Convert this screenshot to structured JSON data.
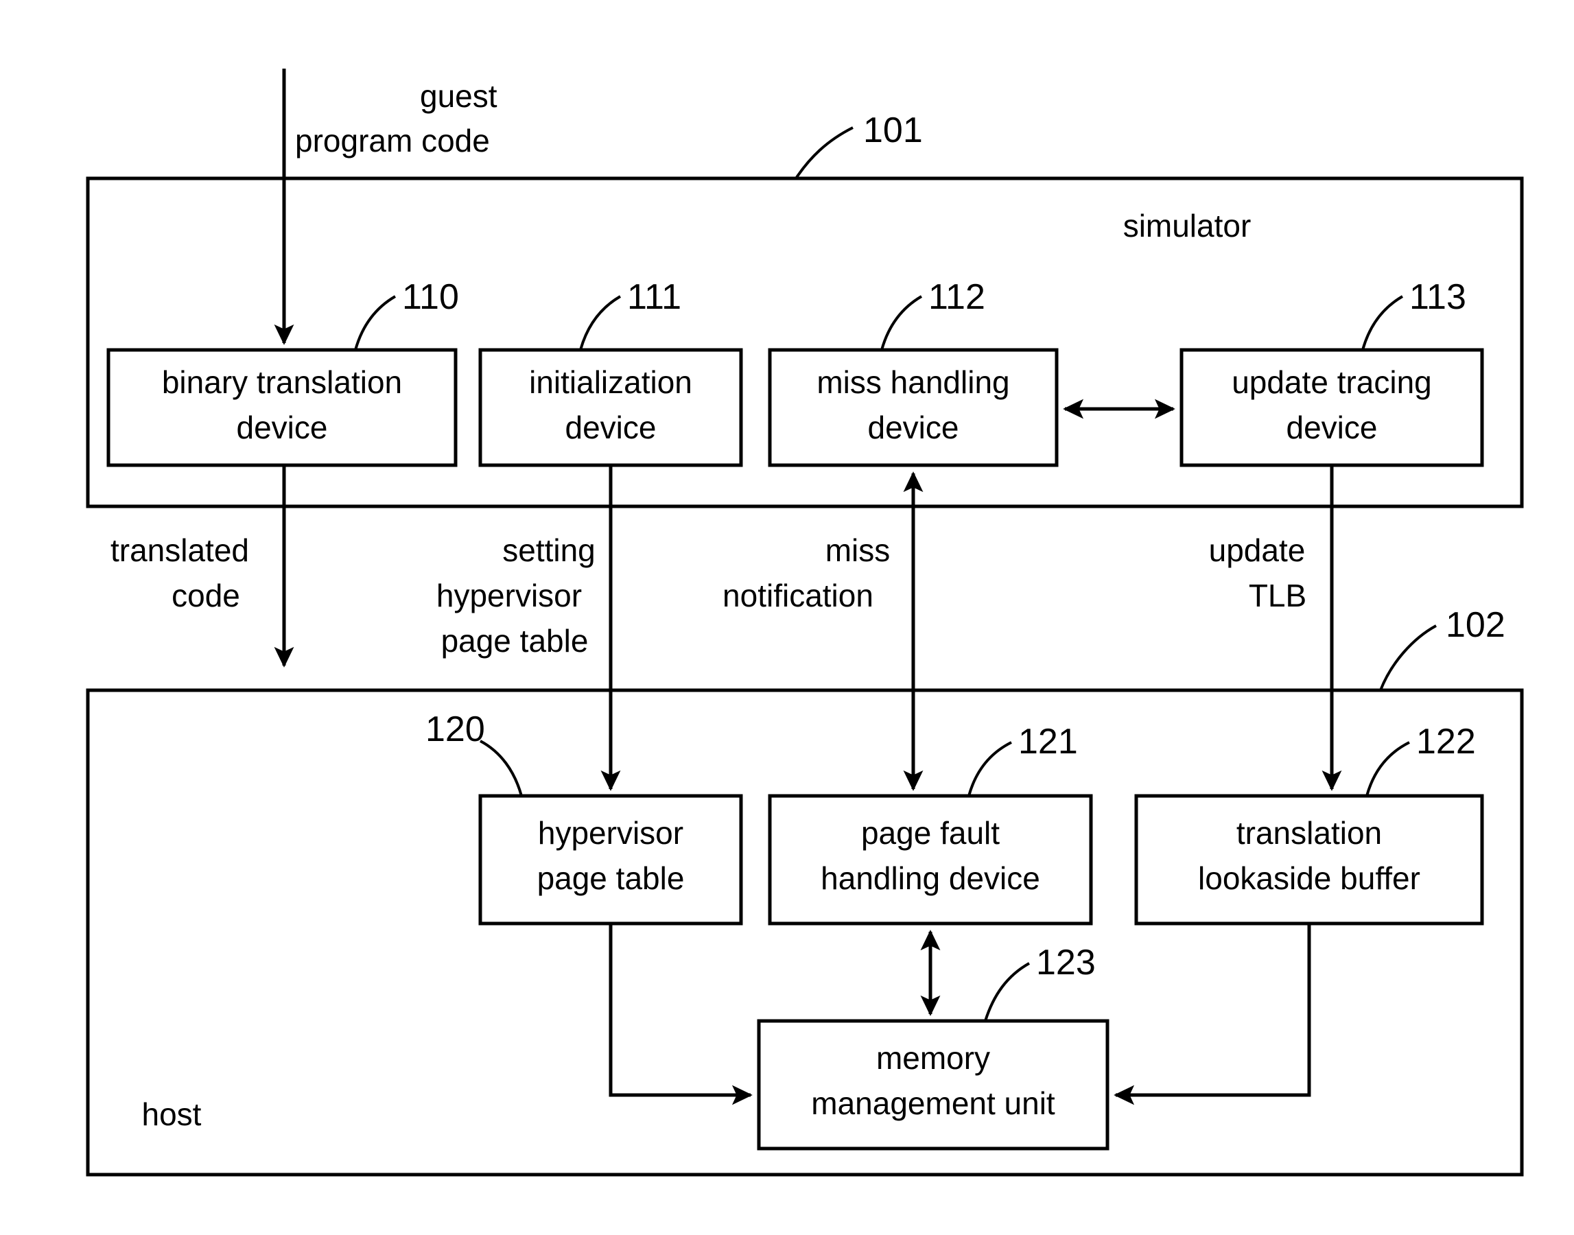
{
  "figure": {
    "type": "patent-block-diagram",
    "background": "#ffffff",
    "stroke": "#000000"
  },
  "input_label": {
    "line1": "guest",
    "line2": "program code"
  },
  "frames": [
    {
      "id": "simulator",
      "label": "simulator",
      "ref": "101"
    },
    {
      "id": "host",
      "label": "host",
      "ref": "102"
    }
  ],
  "simulator_blocks": [
    {
      "ref": "110",
      "line1": "binary translation",
      "line2": "device"
    },
    {
      "ref": "111",
      "line1": "initialization",
      "line2": "device"
    },
    {
      "ref": "112",
      "line1": "miss handling",
      "line2": "device"
    },
    {
      "ref": "113",
      "line1": "update tracing",
      "line2": "device"
    }
  ],
  "host_blocks": [
    {
      "ref": "120",
      "line1": "hypervisor",
      "line2": "page table"
    },
    {
      "ref": "121",
      "line1": "page fault",
      "line2": "handling device"
    },
    {
      "ref": "122",
      "line1": "translation",
      "line2": "lookaside buffer"
    },
    {
      "ref": "123",
      "line1": "memory",
      "line2": "management unit"
    }
  ],
  "flow_labels": [
    {
      "id": "translated-code",
      "line1": "translated",
      "line2": "code",
      "line3": ""
    },
    {
      "id": "setting-hypervisor-page-table",
      "line1": "setting",
      "line2": "hypervisor",
      "line3": "page table"
    },
    {
      "id": "miss-notification",
      "line1": "miss",
      "line2": "notification",
      "line3": ""
    },
    {
      "id": "update-tlb",
      "line1": "update",
      "line2": "TLB",
      "line3": ""
    }
  ]
}
